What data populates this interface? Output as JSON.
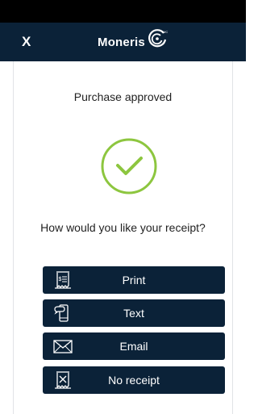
{
  "header": {
    "close_label": "X",
    "brand_name": "Moneris",
    "brand_mark_icon": "moneris-swirl-icon",
    "background": "#0b2238"
  },
  "main": {
    "status": "Purchase approved",
    "status_icon": "checkmark-circle-icon",
    "question": "How would you like your receipt?"
  },
  "receipt_options": [
    {
      "label": "Print",
      "icon": "receipt-print-icon"
    },
    {
      "label": "Text",
      "icon": "phone-text-icon"
    },
    {
      "label": "Email",
      "icon": "envelope-icon"
    },
    {
      "label": "No receipt",
      "icon": "no-receipt-icon"
    }
  ],
  "colors": {
    "accent_green": "#8dc63f",
    "button_bg": "#0b2238",
    "text_dark": "#222222"
  }
}
